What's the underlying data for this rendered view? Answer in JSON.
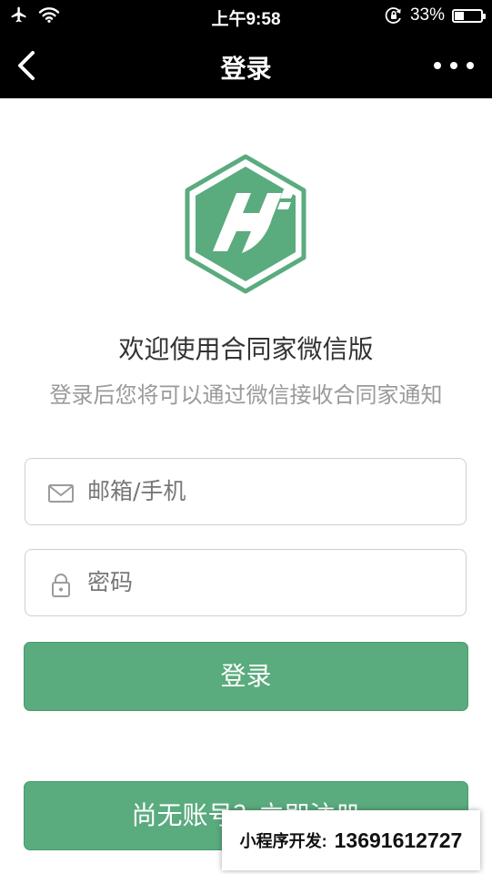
{
  "status_bar": {
    "time": "上午9:58",
    "battery_percent_text": "33%",
    "battery_level": 0.33,
    "icons": [
      "airplane-icon",
      "wifi-icon",
      "orientation-lock-icon",
      "battery-icon"
    ]
  },
  "nav": {
    "title": "登录",
    "back_icon": "chevron-left-icon",
    "more_icon": "more-dots-icon"
  },
  "brand": {
    "logo_icon": "hj-hexagon-logo",
    "logo_color": "#5aab7e"
  },
  "header": {
    "welcome": "欢迎使用合同家微信版",
    "subtitle": "登录后您将可以通过微信接收合同家通知"
  },
  "form": {
    "email": {
      "value": "",
      "placeholder": "邮箱/手机",
      "icon": "mail-icon"
    },
    "password": {
      "value": "",
      "placeholder": "密码",
      "icon": "lock-icon"
    },
    "login_label": "登录",
    "register_label": "尚无账号？立即注册"
  },
  "colors": {
    "primary": "#5aab7e",
    "bar_background": "#000000"
  },
  "watermark": {
    "label": "小程序开发:",
    "phone": "13691612727"
  }
}
